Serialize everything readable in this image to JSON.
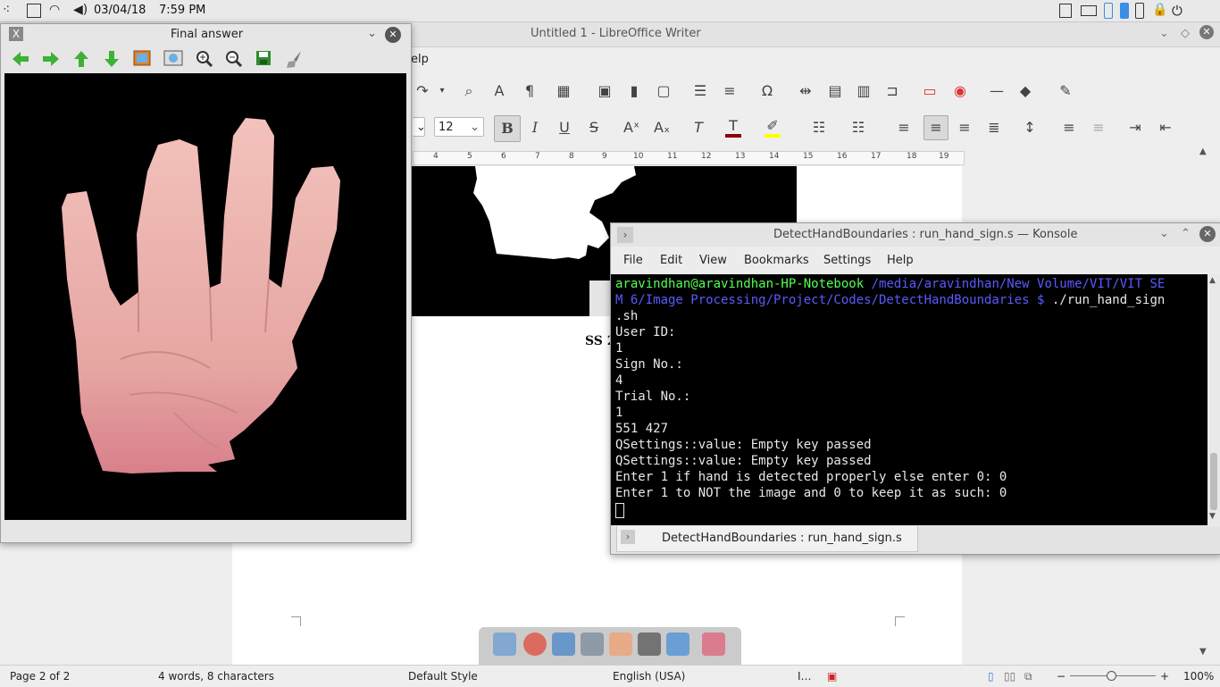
{
  "top_panel": {
    "date": "03/04/18",
    "time": "7:59 PM"
  },
  "writer": {
    "title": "Untitled 1 - LibreOffice Writer",
    "menu_partial": "elp",
    "font_size": "12",
    "ruler_ticks": [
      "4",
      "5",
      "6",
      "7",
      "8",
      "9",
      "10",
      "11",
      "12",
      "13",
      "14",
      "15",
      "16",
      "17",
      "18",
      "19"
    ],
    "doc_text": "SS 2",
    "status": {
      "page": "Page 2 of 2",
      "words": "4 words, 8 characters",
      "style": "Default Style",
      "language": "English (USA)",
      "zoom": "100%"
    }
  },
  "viewer": {
    "title": "Final answer"
  },
  "konsole": {
    "title": "DetectHandBoundaries : run_hand_sign.s — Konsole",
    "menu": [
      "File",
      "Edit",
      "View",
      "Bookmarks",
      "Settings",
      "Help"
    ],
    "prompt_user": "aravindhan@aravindhan-HP-Notebook",
    "prompt_path_1": " /media/aravindhan/New Volume/VIT/VIT SE",
    "prompt_path_2": "M 6/Image Processing/Project/Codes/DetectHandBoundaries $",
    "command_1": " ./run_hand_sign",
    "command_2": ".sh",
    "lines": [
      "User ID:",
      "1",
      "Sign No.:",
      "4",
      "Trial No.:",
      "1",
      "551 427",
      "QSettings::value: Empty key passed",
      "QSettings::value: Empty key passed",
      "Enter 1 if hand is detected properly else enter 0: 0",
      "Enter 1 to NOT the image and 0 to keep it as such: 0"
    ],
    "tab_label": "DetectHandBoundaries : run_hand_sign.s"
  },
  "colors": {
    "prompt_user": "#54ff54",
    "prompt_path": "#5454ff",
    "terminal_bg": "#000000",
    "terminal_fg": "#e8e8e8",
    "skin": "#e9a7a5"
  }
}
